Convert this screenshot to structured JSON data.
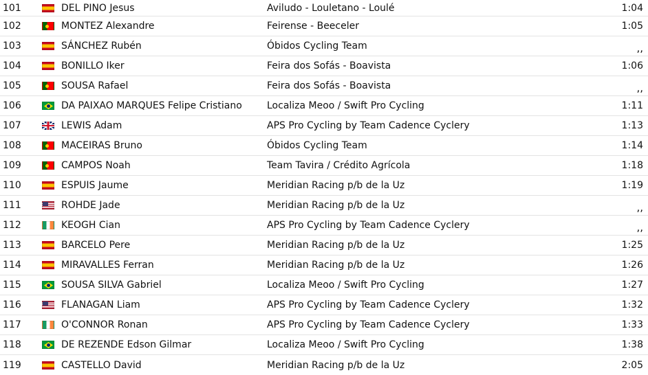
{
  "results": [
    {
      "pos": "101",
      "flag": "spain-flag-icon",
      "rider": "DEL PINO Jesus",
      "team": "Aviludo - Louletano - Loulé",
      "time": "1:04"
    },
    {
      "pos": "102",
      "flag": "portugal-flag-icon",
      "rider": "MONTEZ Alexandre",
      "team": "Feirense - Beeceler",
      "time": "1:05"
    },
    {
      "pos": "103",
      "flag": "spain-flag-icon",
      "rider": "SÁNCHEZ Rubén",
      "team": "Óbidos Cycling Team",
      "time": ",,"
    },
    {
      "pos": "104",
      "flag": "spain-flag-icon",
      "rider": "BONILLO Iker",
      "team": "Feira dos Sofás - Boavista",
      "time": "1:06"
    },
    {
      "pos": "105",
      "flag": "portugal-flag-icon",
      "rider": "SOUSA Rafael",
      "team": "Feira dos Sofás - Boavista",
      "time": ",,"
    },
    {
      "pos": "106",
      "flag": "brazil-flag-icon",
      "rider": "DA PAIXAO MARQUES Felipe Cristiano",
      "team": "Localiza Meoo / Swift Pro Cycling",
      "time": "1:11"
    },
    {
      "pos": "107",
      "flag": "uk-flag-icon",
      "rider": "LEWIS Adam",
      "team": "APS Pro Cycling by Team Cadence Cyclery",
      "time": "1:13"
    },
    {
      "pos": "108",
      "flag": "portugal-flag-icon",
      "rider": "MACEIRAS Bruno",
      "team": "Óbidos Cycling Team",
      "time": "1:14"
    },
    {
      "pos": "109",
      "flag": "portugal-flag-icon",
      "rider": "CAMPOS Noah",
      "team": "Team Tavira / Crédito Agrícola",
      "time": "1:18"
    },
    {
      "pos": "110",
      "flag": "spain-flag-icon",
      "rider": "ESPUIS Jaume",
      "team": "Meridian Racing p/b de la Uz",
      "time": "1:19"
    },
    {
      "pos": "111",
      "flag": "usa-flag-icon",
      "rider": "ROHDE Jade",
      "team": "Meridian Racing p/b de la Uz",
      "time": ",,"
    },
    {
      "pos": "112",
      "flag": "ireland-flag-icon",
      "rider": "KEOGH Cian",
      "team": "APS Pro Cycling by Team Cadence Cyclery",
      "time": ",,"
    },
    {
      "pos": "113",
      "flag": "spain-flag-icon",
      "rider": "BARCELO Pere",
      "team": "Meridian Racing p/b de la Uz",
      "time": "1:25"
    },
    {
      "pos": "114",
      "flag": "spain-flag-icon",
      "rider": "MIRAVALLES Ferran",
      "team": "Meridian Racing p/b de la Uz",
      "time": "1:26"
    },
    {
      "pos": "115",
      "flag": "brazil-flag-icon",
      "rider": "SOUSA SILVA Gabriel",
      "team": "Localiza Meoo / Swift Pro Cycling",
      "time": "1:27"
    },
    {
      "pos": "116",
      "flag": "usa-flag-icon",
      "rider": "FLANAGAN Liam",
      "team": "APS Pro Cycling by Team Cadence Cyclery",
      "time": "1:32"
    },
    {
      "pos": "117",
      "flag": "ireland-flag-icon",
      "rider": "O'CONNOR Ronan",
      "team": "APS Pro Cycling by Team Cadence Cyclery",
      "time": "1:33"
    },
    {
      "pos": "118",
      "flag": "brazil-flag-icon",
      "rider": "DE REZENDE Edson Gilmar",
      "team": "Localiza Meoo / Swift Pro Cycling",
      "time": "1:38"
    },
    {
      "pos": "119",
      "flag": "spain-flag-icon",
      "rider": "CASTELLO David",
      "team": "Meridian Racing p/b de la Uz",
      "time": "2:05"
    }
  ]
}
